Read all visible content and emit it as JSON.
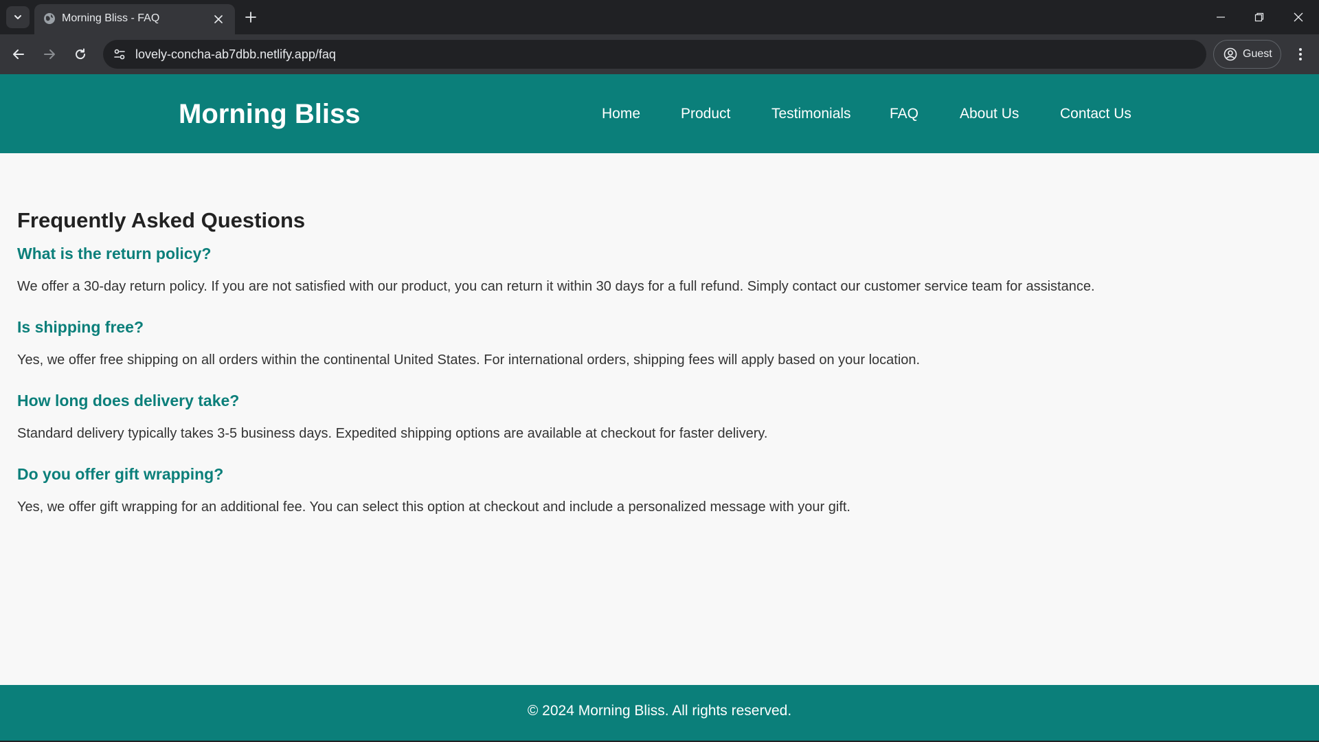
{
  "browser": {
    "tab_title": "Morning Bliss - FAQ",
    "url": "lovely-concha-ab7dbb.netlify.app/faq",
    "profile_label": "Guest"
  },
  "site": {
    "brand": "Morning Bliss",
    "nav": [
      "Home",
      "Product",
      "Testimonials",
      "FAQ",
      "About Us",
      "Contact Us"
    ]
  },
  "faq": {
    "title": "Frequently Asked Questions",
    "items": [
      {
        "question": "What is the return policy?",
        "answer": "We offer a 30-day return policy. If you are not satisfied with our product, you can return it within 30 days for a full refund. Simply contact our customer service team for assistance."
      },
      {
        "question": "Is shipping free?",
        "answer": "Yes, we offer free shipping on all orders within the continental United States. For international orders, shipping fees will apply based on your location."
      },
      {
        "question": "How long does delivery take?",
        "answer": "Standard delivery typically takes 3-5 business days. Expedited shipping options are available at checkout for faster delivery."
      },
      {
        "question": "Do you offer gift wrapping?",
        "answer": "Yes, we offer gift wrapping for an additional fee. You can select this option at checkout and include a personalized message with your gift."
      }
    ]
  },
  "footer": {
    "text": "© 2024 Morning Bliss. All rights reserved."
  },
  "colors": {
    "brand_teal": "#0b7f7a",
    "page_bg": "#f8f8f8",
    "chrome_dark": "#202124",
    "chrome_toolbar": "#35363a"
  }
}
